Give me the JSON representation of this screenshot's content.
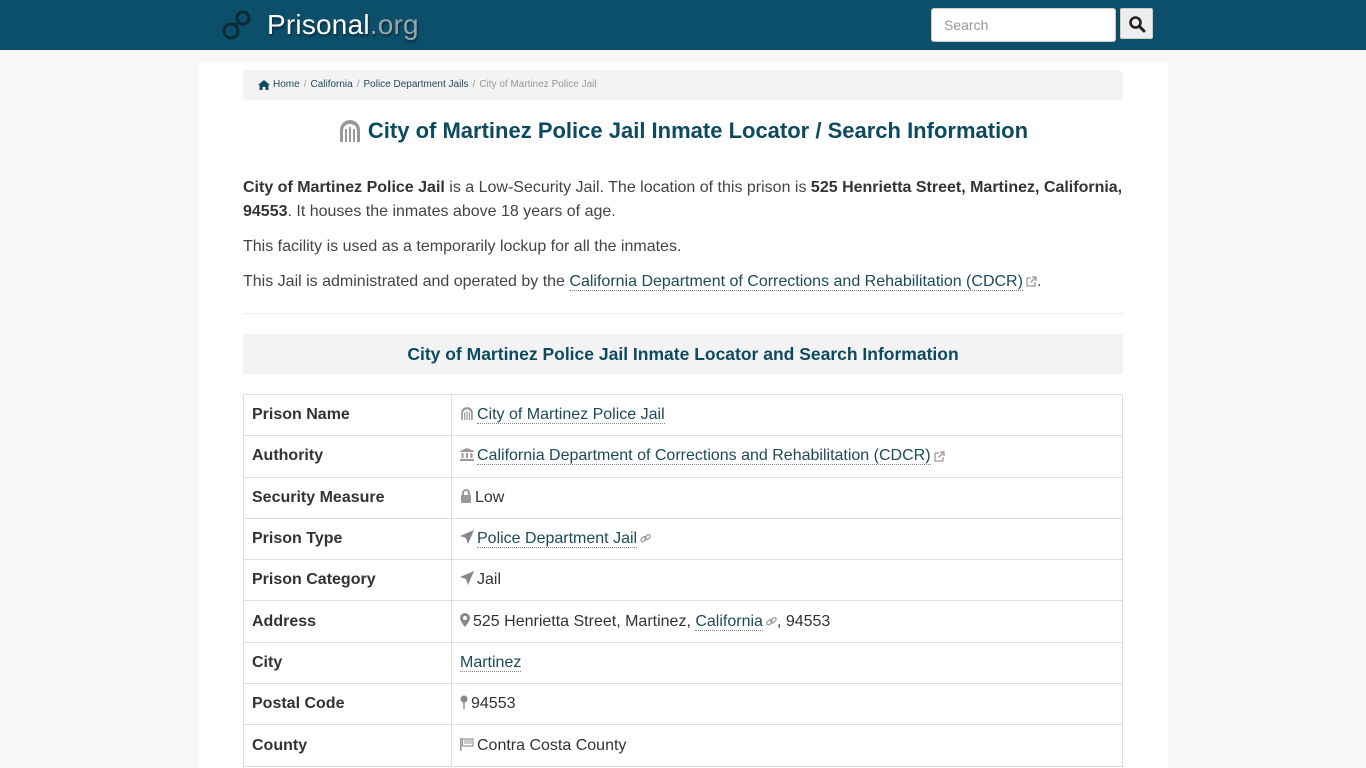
{
  "header": {
    "logo_name": "Prisonal",
    "logo_tld": ".org",
    "search_placeholder": "Search",
    "search_icon": "search-icon"
  },
  "breadcrumb": {
    "items": [
      {
        "label": "Home",
        "icon": "home-icon"
      },
      {
        "label": "California"
      },
      {
        "label": "Police Department Jails"
      }
    ],
    "current": "City of Martinez Police Jail"
  },
  "page": {
    "title": "City of Martinez Police Jail Inmate Locator / Search Information",
    "title_icon": "prison-gate-icon"
  },
  "intro": {
    "p1_name": "City of Martinez Police Jail",
    "p1_mid": " is a Low-Security Jail. The location of this prison is ",
    "p1_address": "525 Henrietta Street, Martinez, California, 94553",
    "p1_end": ". It houses the inmates above 18 years of age.",
    "p2": "This facility is used as a temporarily lockup for all the inmates.",
    "p3_start": "This Jail is administrated and operated by the ",
    "p3_link": "California Department of Corrections and Rehabilitation (CDCR)",
    "p3_end": "."
  },
  "section": {
    "title": "City of Martinez Police Jail Inmate Locator and Search Information"
  },
  "table": {
    "rows": [
      {
        "label": "Prison Name",
        "value": "City of Martinez Police Jail",
        "icon": "prison-gate-icon",
        "link": true
      },
      {
        "label": "Authority",
        "value": "California Department of Corrections and Rehabilitation (CDCR)",
        "icon": "institution-icon",
        "link": true,
        "external": true
      },
      {
        "label": "Security Measure",
        "value": "Low",
        "icon": "lock-icon"
      },
      {
        "label": "Prison Type",
        "value": "Police Department Jail",
        "icon": "location-arrow-icon",
        "link": true,
        "chain": true
      },
      {
        "label": "Prison Category",
        "value": "Jail",
        "icon": "location-arrow-icon"
      },
      {
        "label": "Address",
        "value_pre": "525 Henrietta Street, Martinez, ",
        "value_link": "California",
        "value_post": ", 94553",
        "icon": "map-marker-icon"
      },
      {
        "label": "City",
        "value": "Martinez",
        "link": true
      },
      {
        "label": "Postal Code",
        "value": "94553",
        "icon": "map-pin-icon"
      },
      {
        "label": "County",
        "value": "Contra Costa County",
        "icon": "flag-icon"
      }
    ]
  },
  "colors": {
    "header_bg": "#0c4f6b",
    "title": "#0c4a60",
    "link": "#1d4a5a"
  }
}
